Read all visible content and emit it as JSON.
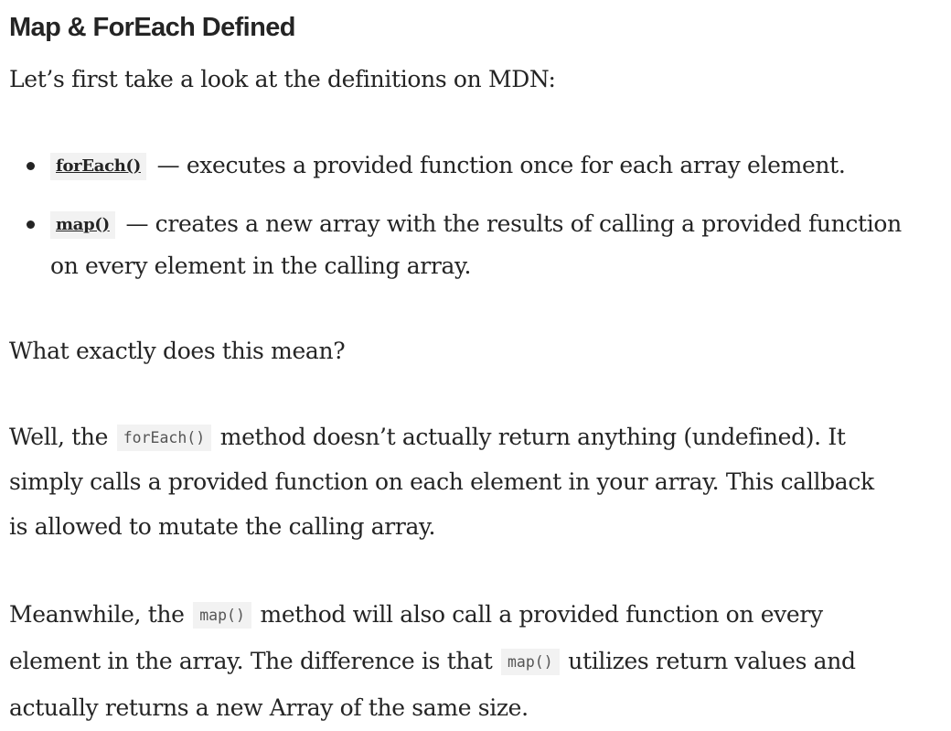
{
  "heading": "Map & ForEach Defined",
  "intro": "Let’s first take a look at the definitions on MDN:",
  "definitions": [
    {
      "term": "forEach()",
      "line1": " — executes a provided function once for each array element."
    },
    {
      "term": "map()",
      "line1": " — creates a new array with the results of calling a provided function",
      "line2": "on every element in the calling array."
    }
  ],
  "question": "What exactly does this mean?",
  "foreach_paragraph": {
    "pre": "Well, the ",
    "code": "forEach()",
    "line1_post": " method doesn’t actually return anything (undefined). It",
    "line2": "simply calls a provided function on each element in your array. This callback",
    "line3": "is allowed to mutate the calling array."
  },
  "map_paragraph": {
    "pre": "Meanwhile, the ",
    "code": "map()",
    "line1_post": " method will also call a provided function on every",
    "line2_pre": "element in the array. The difference is that ",
    "code2": "map()",
    "line2_post": " utilizes return values and",
    "line3": "actually returns a new Array of the same size."
  }
}
